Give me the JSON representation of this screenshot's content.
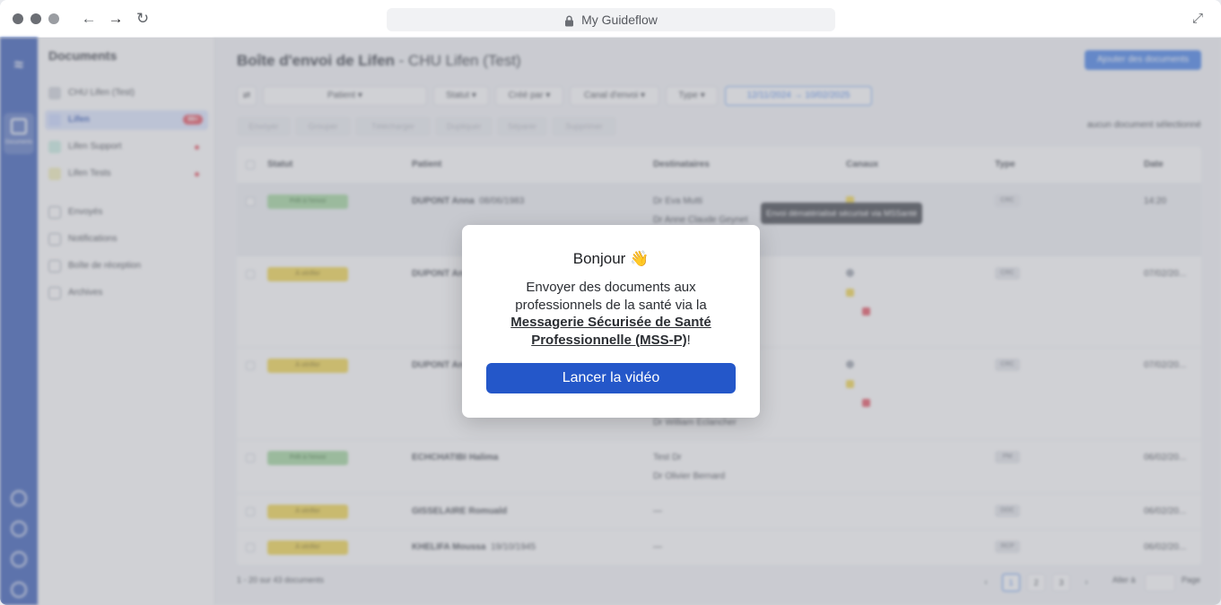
{
  "browser": {
    "url_title": "My Guideflow"
  },
  "rail": {
    "documents_label": "Documents"
  },
  "sidebar": {
    "title": "Documents",
    "org": "CHU Lifen (Test)",
    "items": [
      {
        "label": "Lifen",
        "badge": "99+",
        "abbr": "L"
      },
      {
        "label": "Lifen Support",
        "abbr": "LS"
      },
      {
        "label": "Lifen Tests",
        "abbr": "LT"
      }
    ],
    "nav": [
      {
        "label": "Envoyés"
      },
      {
        "label": "Notifications"
      },
      {
        "label": "Boîte de réception"
      },
      {
        "label": "Archives"
      }
    ]
  },
  "header": {
    "title_bold": "Boîte d'envoi de Lifen",
    "title_rest": " - CHU Lifen (Test)",
    "add_button": "Ajouter des documents"
  },
  "filters": {
    "patient": "Patient",
    "statut": "Statut",
    "cree_par": "Créé par",
    "canal": "Canal d'envoi",
    "type": "Type",
    "date_from": "12/11/2024",
    "date_to": "10/02/2025"
  },
  "actions": {
    "envoyer": "Envoyer",
    "grouper": "Grouper",
    "telecharger": "Télécharger",
    "dupliquer": "Dupliquer",
    "separer": "Séparer",
    "supprimer": "Supprimer",
    "none_selected": "aucun document sélectionné"
  },
  "table": {
    "headers": {
      "statut": "Statut",
      "patient": "Patient",
      "destinataires": "Destinataires",
      "canaux": "Canaux",
      "type": "Type",
      "date": "Date"
    },
    "rows": [
      {
        "status": "Prêt à l'envoi",
        "patient": "DUPONT Anna",
        "dob": "08/06/1983",
        "dest1": "Dr Eva Mutti",
        "dest2": "Dr Anne Claude Geynet",
        "type": "CRC",
        "date": "14:20"
      },
      {
        "status": "À vérifier",
        "patient": "DUPONT An",
        "dob": "",
        "dest1": "",
        "dest2": "",
        "type": "CRC",
        "date": "07/02/20..."
      },
      {
        "status": "À vérifier",
        "patient": "DUPONT An",
        "dob": "",
        "dest1": "",
        "dest2": "Dr William Eclancher",
        "type": "CRC",
        "date": "07/02/20..."
      },
      {
        "status": "Prêt à l'envoi",
        "patient": "ECHCHATIBI Halima",
        "dob": "",
        "dest1": "Test Dr",
        "dest2": "Dr Olivier Bernard",
        "type": "PM",
        "date": "06/02/20..."
      },
      {
        "status": "À vérifier",
        "patient": "GISSELAIRE Romuald",
        "dob": "",
        "dest1": "—",
        "dest2": "",
        "type": "DOC",
        "date": "06/02/20..."
      },
      {
        "status": "À vérifier",
        "patient": "KHELIFA Moussa",
        "dob": "19/10/1945",
        "dest1": "—",
        "dest2": "",
        "type": "RCP",
        "date": "06/02/20..."
      }
    ],
    "tooltip": "Envoi dématérialisé sécurisé via MSSanté"
  },
  "pagination": {
    "summary": "1 - 20 sur 43 documents",
    "pages": [
      "1",
      "2",
      "3"
    ],
    "goto": "Aller à",
    "page_label": "Page"
  },
  "modal": {
    "title": "Bonjour 👋",
    "body_pre": "Envoyer des documents aux professionnels de la santé via la ",
    "body_link": "Messagerie Sécurisée de Santé Professionnelle (MSS-P)",
    "body_post": "!",
    "button": "Lancer la vidéo"
  },
  "colors": {
    "primary": "#2457c9",
    "rail": "#2f55b5",
    "ready": "#9fd69a",
    "verify": "#f2d545"
  }
}
